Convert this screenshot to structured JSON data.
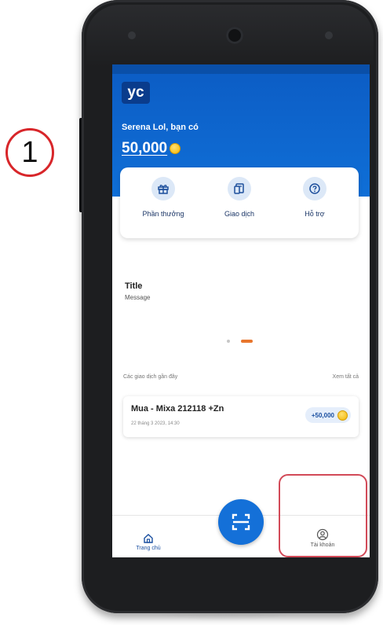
{
  "annotation": {
    "step_number": "1"
  },
  "app": {
    "logo_text": "yc",
    "greeting": "Serena Lol, bạn có",
    "balance": "50,000"
  },
  "quick_actions": [
    {
      "label": "Phần thưởng",
      "icon": "gift-icon"
    },
    {
      "label": "Giao dịch",
      "icon": "receipt-icon"
    },
    {
      "label": "Hỗ trợ",
      "icon": "help-icon"
    }
  ],
  "banner": {
    "title": "Title",
    "message": "Message"
  },
  "transactions": {
    "header": "Các giao dịch gần đây",
    "see_all": "Xem tất cả",
    "items": [
      {
        "title": "Mua - Mixa 212118 +Zn",
        "date": "22 tháng 3 2023, 14:30",
        "amount": "+50,000"
      }
    ]
  },
  "bottom_nav": {
    "home_label": "Trang chủ",
    "account_label": "Tài khoản",
    "scan_icon": "scan-icon"
  },
  "colors": {
    "brand_blue": "#0f6fd7",
    "coin_gold": "#f2b705",
    "highlight_red": "#d24a58",
    "indicator_orange": "#e8762d"
  }
}
